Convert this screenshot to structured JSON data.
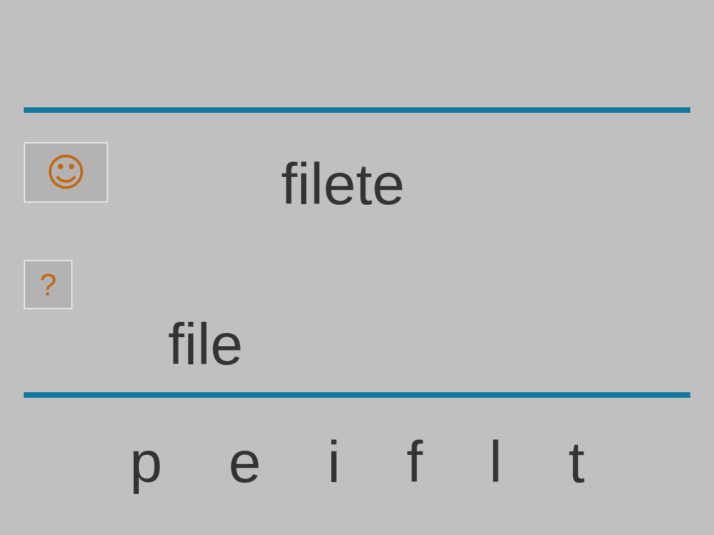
{
  "smiley_button": {
    "label": "☺"
  },
  "target_word": "filete",
  "help_button": {
    "label": "?"
  },
  "answer": "file",
  "letter_tiles": [
    "p",
    "e",
    "i",
    "f",
    "l",
    "t"
  ]
}
